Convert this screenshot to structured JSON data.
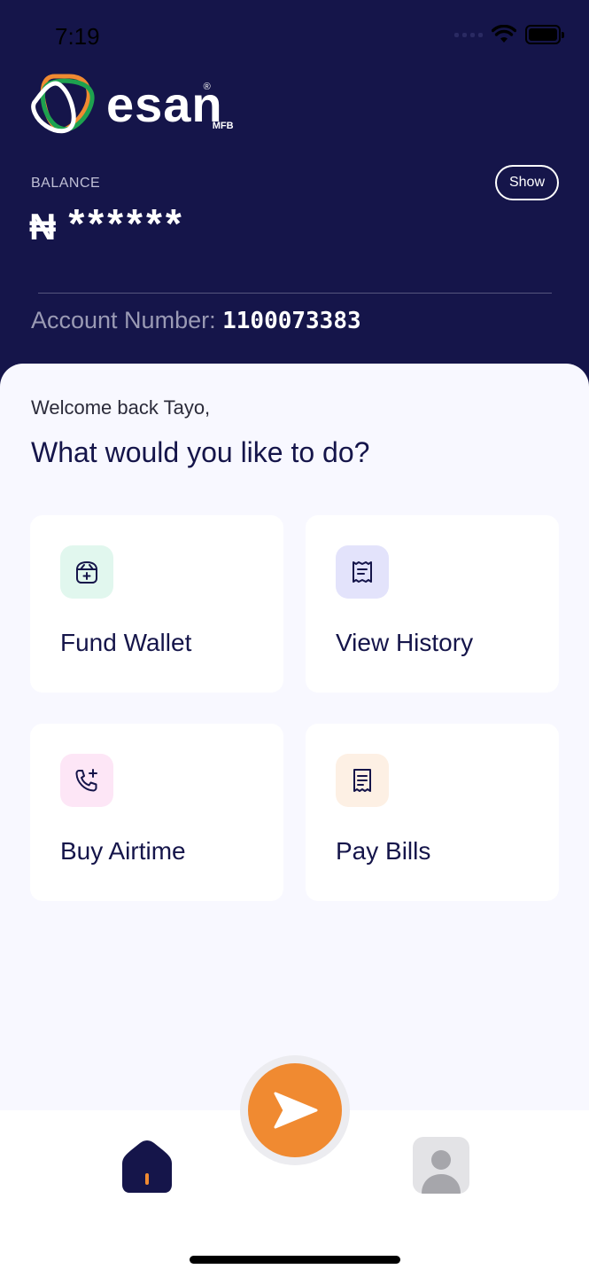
{
  "status_bar": {
    "time": "7:19"
  },
  "brand": {
    "name": "esan",
    "suffix": "MFB",
    "registered": "®"
  },
  "balance": {
    "label": "BALANCE",
    "currency_symbol": "₦",
    "masked_value": "******",
    "show_label": "Show"
  },
  "account": {
    "label": "Account Number:",
    "number": "1100073383"
  },
  "greeting": {
    "welcome": "Welcome back Tayo,",
    "question": "What would you like to do?"
  },
  "actions": [
    {
      "label": "Fund Wallet",
      "icon": "wallet-add-icon",
      "icon_bg": "#e1f7ee"
    },
    {
      "label": "View History",
      "icon": "receipt-icon",
      "icon_bg": "#e3e3fb"
    },
    {
      "label": "Buy Airtime",
      "icon": "phone-add-icon",
      "icon_bg": "#fde6f6"
    },
    {
      "label": "Pay Bills",
      "icon": "bill-icon",
      "icon_bg": "#fdf0e4"
    }
  ],
  "nav": {
    "home_icon": "home-icon",
    "send_icon": "send-icon",
    "profile_icon": "profile-icon"
  },
  "colors": {
    "primary": "#15154a",
    "accent": "#f08a31",
    "background": "#f8f8ff"
  }
}
